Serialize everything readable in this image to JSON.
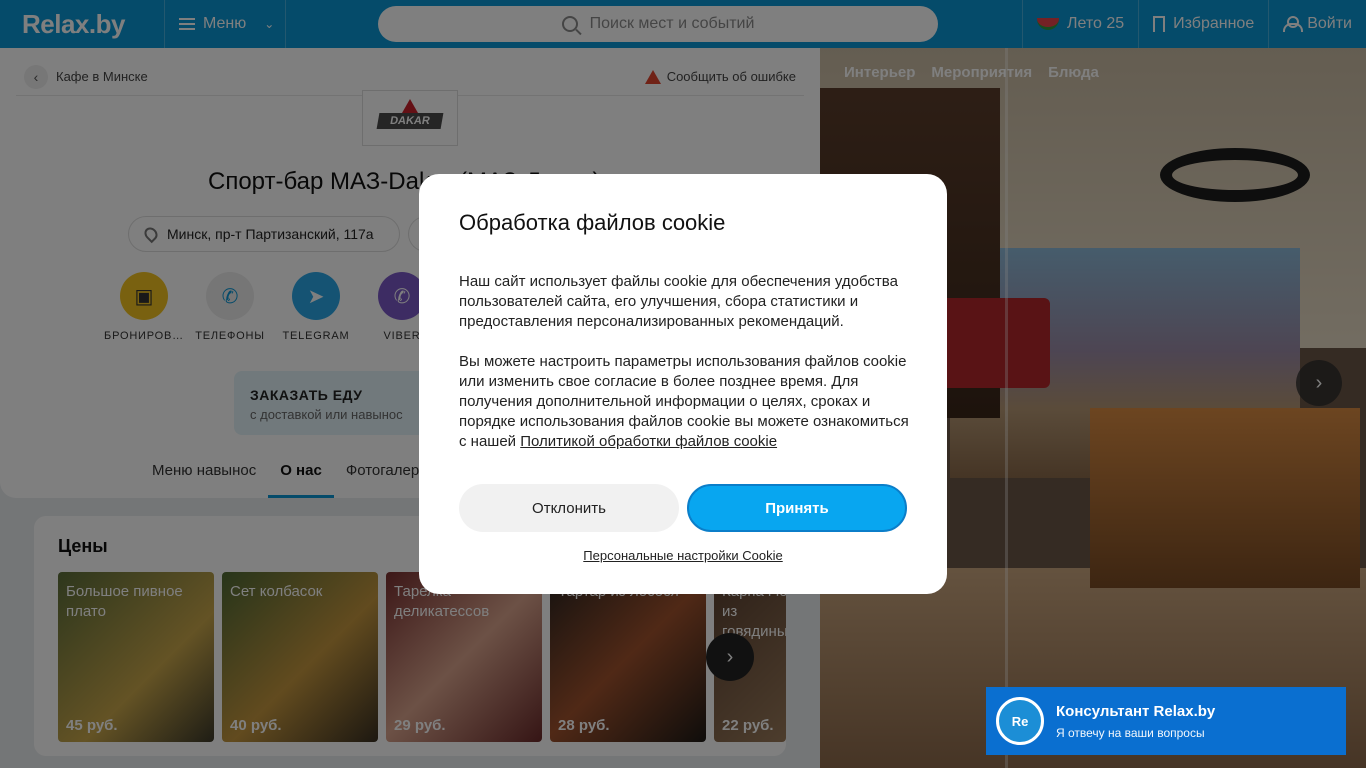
{
  "header": {
    "logo": "Relax.by",
    "menu_label": "Меню",
    "search_placeholder": "Поиск мест и событий",
    "summer_label": "Лето 25",
    "favorites_label": "Избранное",
    "login_label": "Войти"
  },
  "breadcrumb": {
    "back_label": "Кафе в Минске",
    "report_label": "Сообщить об ошибке"
  },
  "venue": {
    "logo_text": "DAKAR",
    "title": "Спорт-бар МАЗ-Dakar (МАЗ-Дакар)",
    "address": "Минск, пр-т Партизанский, 117а"
  },
  "actions": [
    {
      "label": "БРОНИРОВ…",
      "color": "#f2c320"
    },
    {
      "label": "ТЕЛЕФОНЫ",
      "color": "#ececec"
    },
    {
      "label": "TELEGRAM",
      "color": "#2aa7e6"
    },
    {
      "label": "VIBER",
      "color": "#7b58c6"
    }
  ],
  "order_food": {
    "title": "ЗАКАЗАТЬ ЕДУ",
    "subtitle": "с доставкой или навынос"
  },
  "tabs": [
    "Меню навынос",
    "О нас",
    "Фотогалерея"
  ],
  "prices": {
    "title": "Цены",
    "items": [
      {
        "name": "Большое пивное плато",
        "price": "45 руб.",
        "color": "#5b6e3a"
      },
      {
        "name": "Сет колбасок",
        "price": "40 руб.",
        "color": "#6d5c3b"
      },
      {
        "name": "Тарелка деликатессов",
        "price": "29 руб.",
        "color": "#8e3c3a"
      },
      {
        "name": "Тартар из лосося",
        "price": "28 руб.",
        "color": "#5a3a2a"
      },
      {
        "name": "Карпаччо из говядины",
        "price": "22 руб.",
        "color": "#6a4a3a"
      }
    ]
  },
  "photo_tabs": [
    "Интерьер",
    "Мероприятия",
    "Блюда"
  ],
  "consultant": {
    "avatar": "Re",
    "title": "Консультант Relax.by",
    "subtitle": "Я отвечу на ваши вопросы"
  },
  "cookie_modal": {
    "title": "Обработка файлов cookie",
    "paragraph1": "Наш сайт использует файлы cookie для обеспечения удобства пользователей сайта, его улучшения, сбора статистики и предоставления персонализированных рекомендаций.",
    "paragraph2": "Вы можете настроить параметры использования файлов cookie или изменить свое согласие в более позднее время. Для получения дополнительной информации о целях, сроках и порядке использования файлов cookie вы можете ознакомиться с нашей",
    "policy_link": "Политикой обработки файлов cookie",
    "decline_label": "Отклонить",
    "accept_label": "Принять",
    "personal_settings_label": "Персональные настройки Cookie"
  }
}
